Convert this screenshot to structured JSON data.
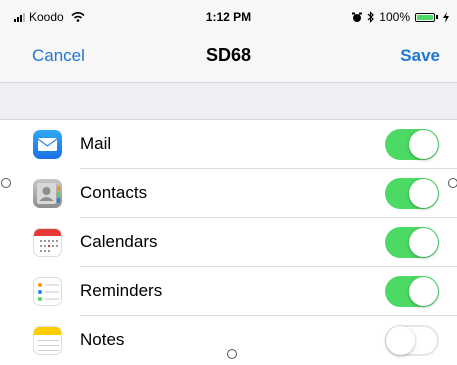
{
  "status_bar": {
    "carrier": "Koodo",
    "time": "1:12 PM",
    "battery": "100%",
    "icons": [
      "signal-icon",
      "wifi-icon",
      "alarm-icon",
      "bluetooth-icon",
      "battery-icon",
      "charging-icon"
    ]
  },
  "nav": {
    "cancel_label": "Cancel",
    "title": "SD68",
    "save_label": "Save"
  },
  "items": [
    {
      "label": "Mail",
      "icon": "mail-icon",
      "enabled": true
    },
    {
      "label": "Contacts",
      "icon": "contacts-icon",
      "enabled": true
    },
    {
      "label": "Calendars",
      "icon": "calendar-icon",
      "enabled": true
    },
    {
      "label": "Reminders",
      "icon": "reminders-icon",
      "enabled": true
    },
    {
      "label": "Notes",
      "icon": "notes-icon",
      "enabled": false
    }
  ],
  "colors": {
    "accent": "#1f78d1",
    "toggle_on": "#4cd964",
    "group_background": "#efeff4"
  }
}
